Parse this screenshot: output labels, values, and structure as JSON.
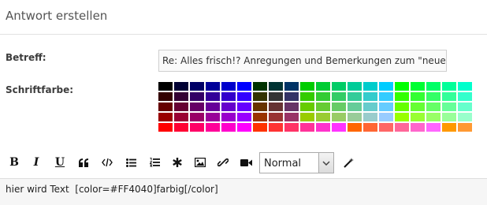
{
  "header": {
    "title": "Antwort erstellen"
  },
  "form": {
    "subject_label": "Betreff:",
    "subject_value": "Re: Alles frisch!? Anregungen und Bemerkungen zum \"neue",
    "fontcolor_label": "Schriftfarbe:"
  },
  "palette": [
    [
      "#000000",
      "#000033",
      "#000066",
      "#000099",
      "#0000CC",
      "#0000FF",
      "#003300",
      "#003333",
      "#003366",
      "#003399",
      "#0033CC",
      "#0033FF",
      "#006600",
      "#006633",
      "#006666",
      "#006699",
      "#0066CC",
      "#0066FF",
      "#009900",
      "#009933"
    ],
    [
      "#330000",
      "#330033",
      "#330066",
      "#330099",
      "#3300CC",
      "#3300FF",
      "#333300",
      "#333333",
      "#333366",
      "#333399",
      "#3333CC",
      "#3333FF",
      "#336600",
      "#336633",
      "#336666",
      "#336699",
      "#3366CC",
      "#3366FF",
      "#339900",
      "#339933"
    ],
    [
      "#660000",
      "#660033",
      "#660066",
      "#660099",
      "#6600CC",
      "#6600FF",
      "#663300",
      "#663333",
      "#663366",
      "#663399",
      "#6633CC",
      "#6633FF",
      "#666600",
      "#666633",
      "#666666",
      "#666699",
      "#6666CC",
      "#6666FF",
      "#669900",
      "#669933"
    ],
    [
      "#990000",
      "#990033",
      "#990066",
      "#990099",
      "#9900CC",
      "#9900FF",
      "#993300",
      "#993333",
      "#993366",
      "#993399",
      "#9933CC",
      "#9933FF",
      "#996600",
      "#996633",
      "#996666",
      "#996699",
      "#9966CC",
      "#9966FF",
      "#999900",
      "#999933"
    ],
    [
      "#CC0000",
      "#CC0033",
      "#CC0066",
      "#CC0099",
      "#CC00CC",
      "#CC00FF",
      "#CC3300",
      "#CC3333",
      "#CC3366",
      "#CC3399",
      "#CC33CC",
      "#CC33FF",
      "#CC6600",
      "#CC6633",
      "#CC6666",
      "#CC6699",
      "#CC66CC",
      "#CC66FF",
      "#CC9900",
      "#CC9933"
    ]
  ],
  "palette_bright": [
    [
      "#00CC00",
      "#00CC33",
      "#00CC66",
      "#00CC99",
      "#00CCCC",
      "#00CCFF",
      "#00FF00",
      "#00FF33",
      "#00FF66",
      "#00FF99",
      "#00FFCC",
      "#00FFFF"
    ],
    [
      "#33CC00",
      "#33CC33",
      "#33CC66",
      "#33CC99",
      "#33CCCC",
      "#33CCFF",
      "#33FF00",
      "#33FF33",
      "#33FF66",
      "#33FF99",
      "#33FFCC",
      "#33FFFF"
    ],
    [
      "#66CC00",
      "#66CC33",
      "#66CC66",
      "#66CC99",
      "#66CCCC",
      "#66CCFF",
      "#66FF00",
      "#66FF33",
      "#66FF66",
      "#66FF99",
      "#66FFCC",
      "#66FFFF"
    ],
    [
      "#99CC00",
      "#99CC33",
      "#99CC66",
      "#99CC99",
      "#99CCCC",
      "#99CCFF",
      "#99FF00",
      "#99FF33",
      "#99FF66",
      "#99FF99",
      "#99FFCC",
      "#99FFFF"
    ],
    [
      "#CCCC00",
      "#CCCC33",
      "#CCCC66",
      "#CCCC99",
      "#CCCCCC",
      "#CCCCFF",
      "#CCFF00",
      "#CCFF33",
      "#CCFF66",
      "#CCFF99",
      "#CCFFCC",
      "#CCFFFF"
    ]
  ],
  "palette_last_row": [
    "#FF0000",
    "#FF0033",
    "#FF0066",
    "#FF0099",
    "#FF00CC",
    "#FF00FF",
    "#FF3300",
    "#FF3333",
    "#FF3366",
    "#FF3399",
    "#FF33CC",
    "#FF33FF",
    "#FF6600",
    "#FF6633",
    "#FF6666",
    "#FF6699",
    "#FF66CC",
    "#FF66FF",
    "#FF9900",
    "#FF9933"
  ],
  "toolbar": {
    "bold": "B",
    "italic": "I",
    "underline": "U",
    "quote_icon": "quote-icon",
    "code_icon": "code-icon",
    "list_icon": "bullet-list-icon",
    "olist_icon": "numbered-list-icon",
    "spoiler_icon": "asterisk-icon",
    "image_icon": "image-icon",
    "link_icon": "link-icon",
    "video_icon": "video-camera-icon",
    "size_selected": "Normal",
    "wand_icon": "magic-wand-icon"
  },
  "editor": {
    "text": "hier wird Text  [color=#FF4040]farbig[/color]"
  }
}
